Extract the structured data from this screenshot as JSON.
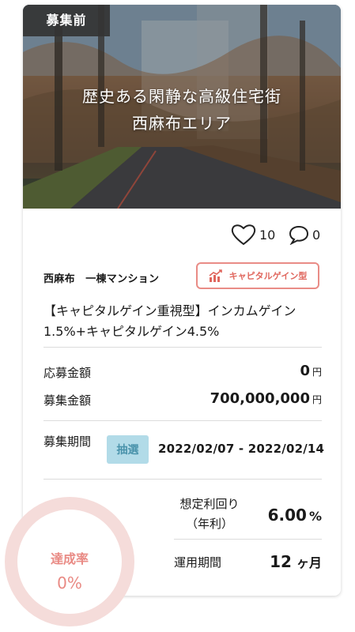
{
  "status_tag": "募集前",
  "hero": {
    "line1": "歴史ある閑静な高級住宅街",
    "line2": "西麻布エリア"
  },
  "social": {
    "likes": "10",
    "comments": "0"
  },
  "location": "西麻布　一棟マンション",
  "type_badge": "キャピタルゲイン型",
  "title": "【キャピタルゲイン重視型】インカムゲイン1.5%+キャピタルゲイン4.5%",
  "applied": {
    "label": "応募金額",
    "value": "0",
    "unit": "円"
  },
  "target": {
    "label": "募集金額",
    "value": "700,000,000",
    "unit": "円"
  },
  "period": {
    "label": "募集期間",
    "method": "抽選",
    "value": "2022/02/07 - 2022/02/14"
  },
  "yield": {
    "label_line1": "想定利回り",
    "label_line2": "（年利）",
    "value": "6.00",
    "unit": "%"
  },
  "term": {
    "label": "運用期間",
    "value": "12",
    "unit": "ヶ月"
  },
  "achievement": {
    "label": "達成率",
    "value": "0%",
    "fraction": 0
  },
  "colors": {
    "accent": "#e0665d",
    "ring": "#f5dcda",
    "lottery_bg": "#b2dbe8"
  }
}
